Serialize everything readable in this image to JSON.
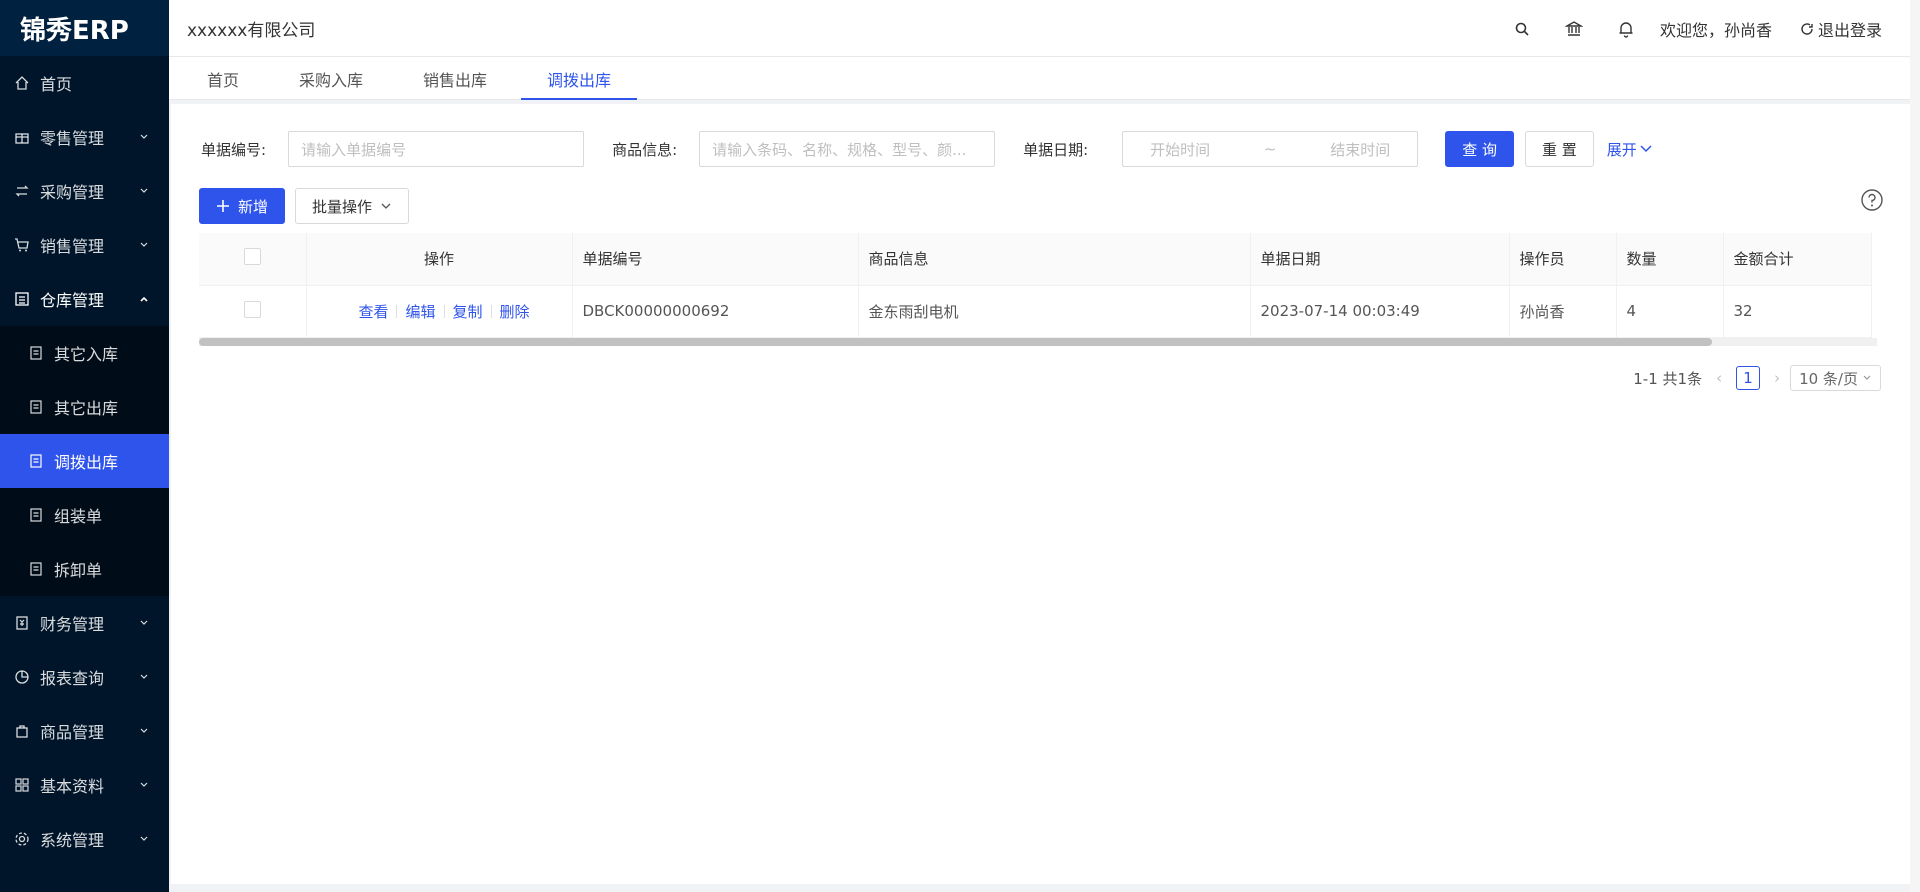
{
  "app": {
    "logo": "锦秀ERP",
    "company": "xxxxxx有限公司"
  },
  "header": {
    "welcome": "欢迎您，孙尚香",
    "logout": "退出登录"
  },
  "sidebar": {
    "items": [
      {
        "label": "首页",
        "icon": "home-icon"
      },
      {
        "label": "零售管理",
        "icon": "gift-icon"
      },
      {
        "label": "采购管理",
        "icon": "swap-icon"
      },
      {
        "label": "销售管理",
        "icon": "cart-icon"
      },
      {
        "label": "仓库管理",
        "icon": "warehouse-icon"
      },
      {
        "label": "财务管理",
        "icon": "finance-icon"
      },
      {
        "label": "报表查询",
        "icon": "pie-chart-icon"
      },
      {
        "label": "商品管理",
        "icon": "bag-icon"
      },
      {
        "label": "基本资料",
        "icon": "grid-icon"
      },
      {
        "label": "系统管理",
        "icon": "settings-icon"
      }
    ],
    "warehouse_sub": [
      "其它入库",
      "其它出库",
      "调拨出库",
      "组装单",
      "拆卸单"
    ]
  },
  "tabs": [
    "首页",
    "采购入库",
    "销售出库",
    "调拨出库"
  ],
  "filters": {
    "doc_no_label": "单据编号:",
    "doc_no_placeholder": "请输入单据编号",
    "goods_label": "商品信息:",
    "goods_placeholder": "请输入条码、名称、规格、型号、颜...",
    "date_label": "单据日期:",
    "start_placeholder": "开始时间",
    "range_sep": "~",
    "end_placeholder": "结束时间",
    "query": "查 询",
    "reset": "重 置",
    "expand": "展开"
  },
  "actions": {
    "add": "新增",
    "batch": "批量操作"
  },
  "table": {
    "columns": [
      "操作",
      "单据编号",
      "商品信息",
      "单据日期",
      "操作员",
      "数量",
      "金额合计"
    ],
    "rows": [
      {
        "ops": [
          "查看",
          "编辑",
          "复制",
          "删除"
        ],
        "doc_no": "DBCK00000000692",
        "goods": "金东雨刮电机",
        "date": "2023-07-14 00:03:49",
        "operator": "孙尚香",
        "qty": "4",
        "amount": "32"
      }
    ]
  },
  "pagination": {
    "summary": "1-1 共1条",
    "current": "1",
    "page_size": "10 条/页"
  },
  "colors": {
    "primary": "#2f54eb",
    "sidebar_bg": "#001529"
  }
}
